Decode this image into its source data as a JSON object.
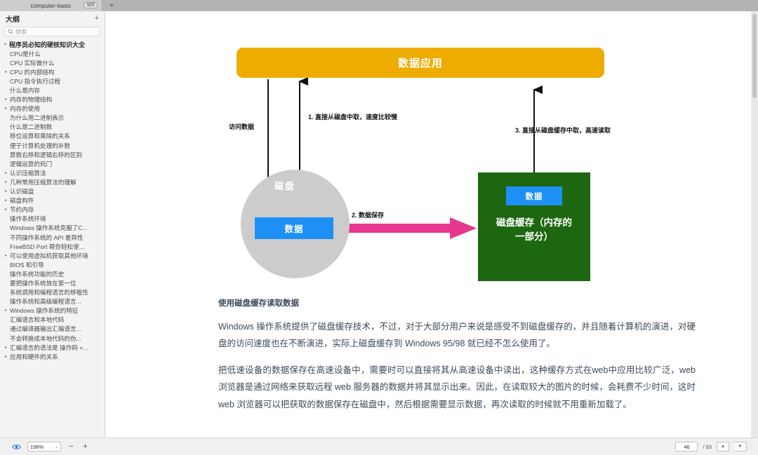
{
  "window": {
    "tab_title": "computer-basic",
    "tab_badge": "编辑",
    "new_tab_label": "+"
  },
  "sidebar": {
    "header_title": "大纲",
    "add_label": "+",
    "search": {
      "placeholder": "搜索",
      "value": "",
      "icon": "search-icon"
    },
    "items": [
      {
        "label": "程序员必知的硬核知识大全",
        "level": 0,
        "twisty": "▾"
      },
      {
        "label": "CPU是什么",
        "level": 1,
        "twisty": ""
      },
      {
        "label": "CPU 实际做什么",
        "level": 1,
        "twisty": ""
      },
      {
        "label": "CPU 的内部结构",
        "level": 1,
        "twisty": "▸"
      },
      {
        "label": "CPU 指令执行过程",
        "level": 1,
        "twisty": ""
      },
      {
        "label": "什么是内存",
        "level": 1,
        "twisty": ""
      },
      {
        "label": "内存的物理结构",
        "level": 1,
        "twisty": "▸"
      },
      {
        "label": "内存的使用",
        "level": 1,
        "twisty": "▸"
      },
      {
        "label": "为什么用二进制表示",
        "level": 1,
        "twisty": ""
      },
      {
        "label": "什么是二进制数",
        "level": 1,
        "twisty": ""
      },
      {
        "label": "移位运算和乘除的关系",
        "level": 1,
        "twisty": ""
      },
      {
        "label": "便于计算机处理的补数",
        "level": 1,
        "twisty": ""
      },
      {
        "label": "算数右移和逻辑右移的区别",
        "level": 1,
        "twisty": ""
      },
      {
        "label": "逻辑运算的窍门",
        "level": 1,
        "twisty": ""
      },
      {
        "label": "认识压缩算法",
        "level": 1,
        "twisty": "▸"
      },
      {
        "label": "几种常用压缩算法的理解",
        "level": 1,
        "twisty": "▸"
      },
      {
        "label": "认识磁盘",
        "level": 1,
        "twisty": "▸"
      },
      {
        "label": "磁盘构件",
        "level": 1,
        "twisty": "▸"
      },
      {
        "label": "节约内存",
        "level": 1,
        "twisty": "▸"
      },
      {
        "label": "操作系统环境",
        "level": 1,
        "twisty": ""
      },
      {
        "label": "Windows 操作系统克服了C...",
        "level": 1,
        "twisty": ""
      },
      {
        "label": "不同操作系统的 API 差异性",
        "level": 1,
        "twisty": ""
      },
      {
        "label": "FreeBSD Port 帮你轻松使...",
        "level": 1,
        "twisty": ""
      },
      {
        "label": "可以使用虚拟机获取其他环境",
        "level": 1,
        "twisty": "▸"
      },
      {
        "label": "BIOS 和引导",
        "level": 1,
        "twisty": ""
      },
      {
        "label": "操作系统功能的历史",
        "level": 1,
        "twisty": ""
      },
      {
        "label": "要把操作系统放在第一位",
        "level": 1,
        "twisty": ""
      },
      {
        "label": "系统调用和编程语言的移植性",
        "level": 1,
        "twisty": ""
      },
      {
        "label": "操作系统和高级编程语言...",
        "level": 1,
        "twisty": ""
      },
      {
        "label": "Windows 操作系统的特征",
        "level": 1,
        "twisty": "▸"
      },
      {
        "label": "汇编语言和本地代码",
        "level": 1,
        "twisty": ""
      },
      {
        "label": "通过编译器输出汇编语言...",
        "level": 1,
        "twisty": ""
      },
      {
        "label": "不会转换成本地代码的伪...",
        "level": 1,
        "twisty": ""
      },
      {
        "label": "汇编语言的语法是 操作码 +...",
        "level": 1,
        "twisty": "▸"
      },
      {
        "label": "应用和硬件的关系",
        "level": 1,
        "twisty": "▸"
      }
    ]
  },
  "diagram": {
    "app_bar_label": "数据应用",
    "disk_label": "磁盘",
    "disk_data_label": "数据",
    "cache_data_label": "数据",
    "cache_box_label": "磁盘缓存（内存的\n一部分）",
    "cache_box_line1": "磁盘缓存（内存的",
    "cache_box_line2": "一部分）",
    "access_label": "访问数据",
    "step1": "1. 直接从磁盘中取，速度比较慢",
    "step2": "2. 数据保存",
    "step3": "3. 直接从磁盘缓存中取，高速读取",
    "colors": {
      "app_bar": "#efac00",
      "disk_circle": "#cccccc",
      "data_box": "#1e90f5",
      "cache_box": "#1d6710",
      "save_arrow": "#e8378f",
      "arrow_line": "#111111"
    }
  },
  "document": {
    "heading": "使用磁盘缓存读取数据",
    "paragraphs": [
      "Windows 操作系统提供了磁盘缓存技术，不过，对于大部分用户来说是感受不到磁盘缓存的，并且随着计算机的演进，对硬盘的访问速度也在不断演进，实际上磁盘缓存到 Windows 95/98 就已经不怎么使用了。",
      "把低速设备的数据保存在高速设备中，需要时可以直接将其从高速设备中读出，这种缓存方式在web中应用比较广泛，web 浏览器是通过网络来获取远程 web 服务器的数据并将其显示出来。因此，在读取较大的图片的时候，会耗费不少时间，这时 web 浏览器可以把获取的数据保存在磁盘中，然后根据需要显示数据，再次读取的时候就不用重新加载了。"
    ]
  },
  "statusbar": {
    "preview_icon": "eye-icon",
    "zoom_value": "198%",
    "zoom_caret": "⌄",
    "zoom_out_label": "−",
    "zoom_in_label": "+",
    "page_current": "46",
    "page_total": "/ 93",
    "prev_page_icon": "▲",
    "next_page_icon": "▼"
  }
}
